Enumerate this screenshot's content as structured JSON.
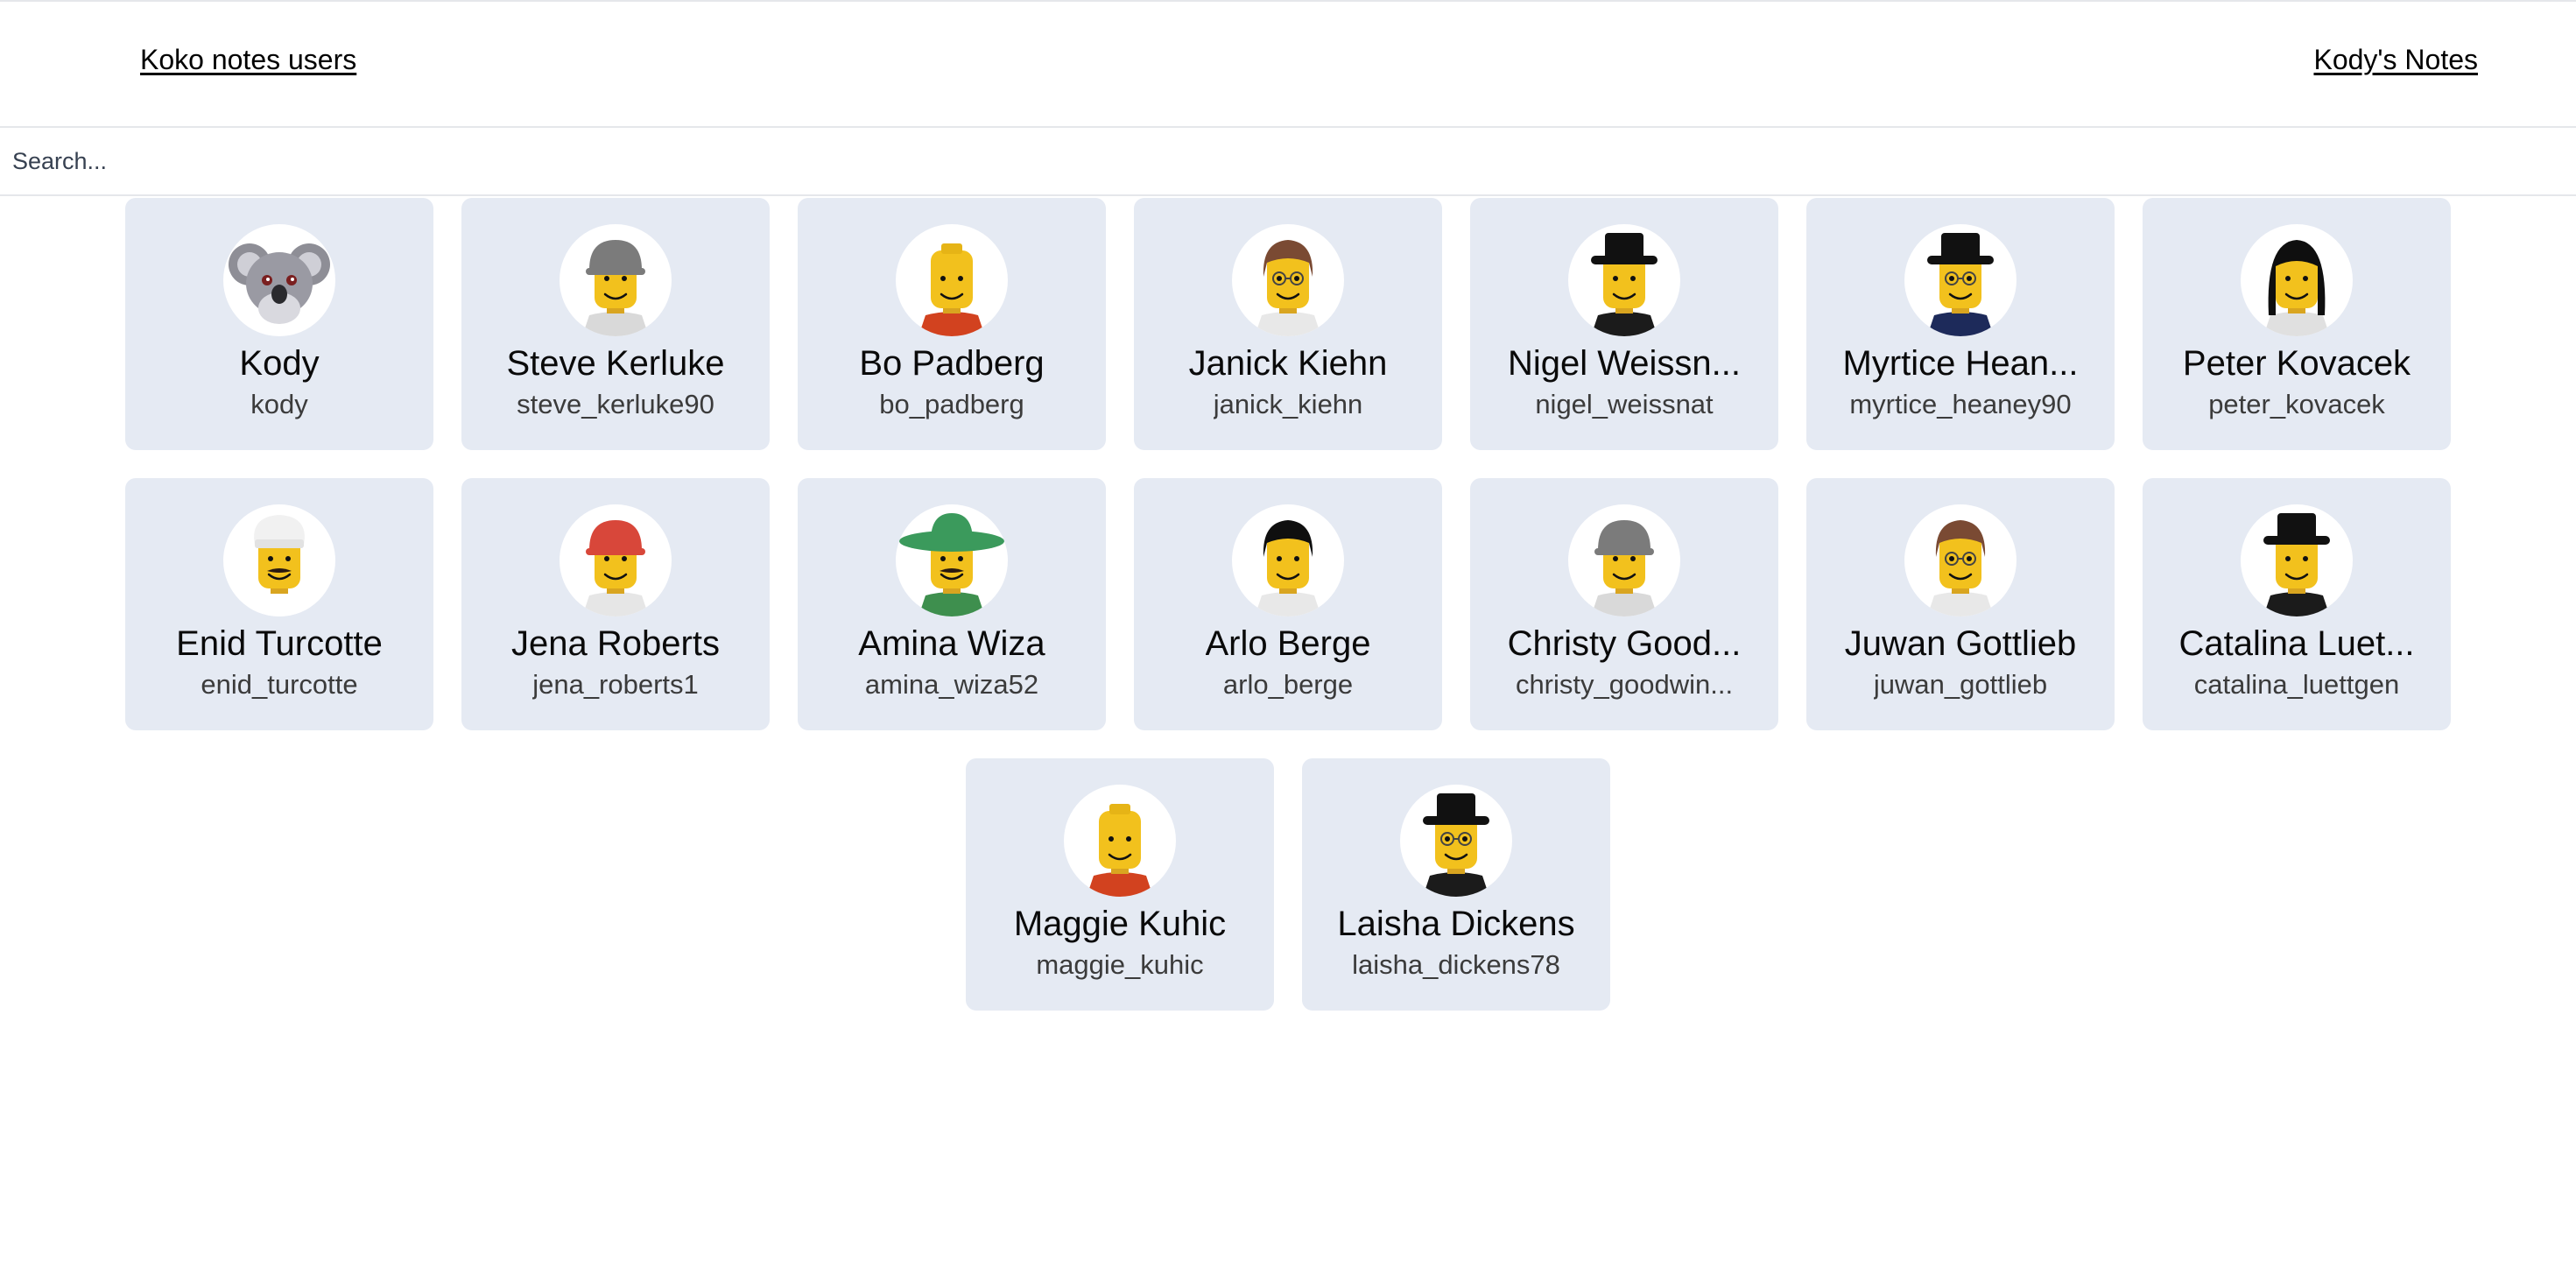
{
  "header": {
    "title": "Koko notes users",
    "notes_link": "Kody's Notes"
  },
  "search": {
    "placeholder": "Search..."
  },
  "colors": {
    "card_background": "#e5eaf3",
    "avatar_background": "#ffffff",
    "page_background": "#ffffff"
  },
  "users": [
    {
      "name": "Kody",
      "username": "kody",
      "avatar": "koala-avatar",
      "hat": "none",
      "hat_color": "",
      "shirt_color": "",
      "glasses": false,
      "mustache": false
    },
    {
      "name": "Steve Kerluke",
      "username": "steve_kerluke90",
      "avatar": "lego-minifig-avatar",
      "hat": "helmet",
      "hat_color": "#7b7b7b",
      "shirt_color": "#d9d9d9",
      "glasses": false,
      "mustache": false
    },
    {
      "name": "Bo Padberg",
      "username": "bo_padberg",
      "avatar": "lego-minifig-avatar",
      "hat": "none",
      "hat_color": "",
      "shirt_color": "#d2421f",
      "glasses": false,
      "mustache": false
    },
    {
      "name": "Janick Kiehn",
      "username": "janick_kiehn",
      "avatar": "lego-minifig-avatar",
      "hat": "hair",
      "hat_color": "#7a4a33",
      "shirt_color": "#e8e8e8",
      "glasses": true,
      "mustache": false
    },
    {
      "name": "Nigel Weissn...",
      "username": "nigel_weissnat",
      "avatar": "lego-minifig-avatar",
      "hat": "tophat",
      "hat_color": "#111111",
      "shirt_color": "#1b1b1b",
      "glasses": false,
      "mustache": false
    },
    {
      "name": "Myrtice Hean...",
      "username": "myrtice_heaney90",
      "avatar": "lego-minifig-avatar",
      "hat": "tophat",
      "hat_color": "#111111",
      "shirt_color": "#1d2a5a",
      "glasses": true,
      "mustache": false
    },
    {
      "name": "Peter Kovacek",
      "username": "peter_kovacek",
      "avatar": "lego-minifig-avatar",
      "hat": "longhair",
      "hat_color": "#0f0f0f",
      "shirt_color": "#e0e0e0",
      "glasses": false,
      "mustache": false
    },
    {
      "name": "Enid Turcotte",
      "username": "enid_turcotte",
      "avatar": "lego-minifig-avatar",
      "hat": "chef",
      "hat_color": "#f1f1f1",
      "shirt_color": "#ffffff",
      "glasses": false,
      "mustache": true
    },
    {
      "name": "Jena Roberts",
      "username": "jena_roberts1",
      "avatar": "lego-minifig-avatar",
      "hat": "helmet",
      "hat_color": "#d8473a",
      "shirt_color": "#e6e6e6",
      "glasses": false,
      "mustache": false
    },
    {
      "name": "Amina Wiza",
      "username": "amina_wiza52",
      "avatar": "lego-minifig-avatar",
      "hat": "sombrero",
      "hat_color": "#3b9a5c",
      "shirt_color": "#3e8f4e",
      "glasses": false,
      "mustache": true
    },
    {
      "name": "Arlo Berge",
      "username": "arlo_berge",
      "avatar": "lego-minifig-avatar",
      "hat": "hair",
      "hat_color": "#0f0f0f",
      "shirt_color": "#e8e8e8",
      "glasses": false,
      "mustache": false
    },
    {
      "name": "Christy Good...",
      "username": "christy_goodwin...",
      "avatar": "lego-minifig-avatar",
      "hat": "helmet",
      "hat_color": "#7b7b7b",
      "shirt_color": "#d9d9d9",
      "glasses": false,
      "mustache": false
    },
    {
      "name": "Juwan Gottlieb",
      "username": "juwan_gottlieb",
      "avatar": "lego-minifig-avatar",
      "hat": "hair",
      "hat_color": "#7a4a33",
      "shirt_color": "#e8e8e8",
      "glasses": true,
      "mustache": false
    },
    {
      "name": "Catalina Luet...",
      "username": "catalina_luettgen",
      "avatar": "lego-minifig-avatar",
      "hat": "tophat",
      "hat_color": "#111111",
      "shirt_color": "#1b1b1b",
      "glasses": false,
      "mustache": false
    },
    {
      "name": "Maggie Kuhic",
      "username": "maggie_kuhic",
      "avatar": "lego-minifig-avatar",
      "hat": "none",
      "hat_color": "",
      "shirt_color": "#d2421f",
      "glasses": false,
      "mustache": false
    },
    {
      "name": "Laisha Dickens",
      "username": "laisha_dickens78",
      "avatar": "lego-minifig-avatar",
      "hat": "tophat",
      "hat_color": "#111111",
      "shirt_color": "#1b1b1b",
      "glasses": true,
      "mustache": false
    }
  ]
}
